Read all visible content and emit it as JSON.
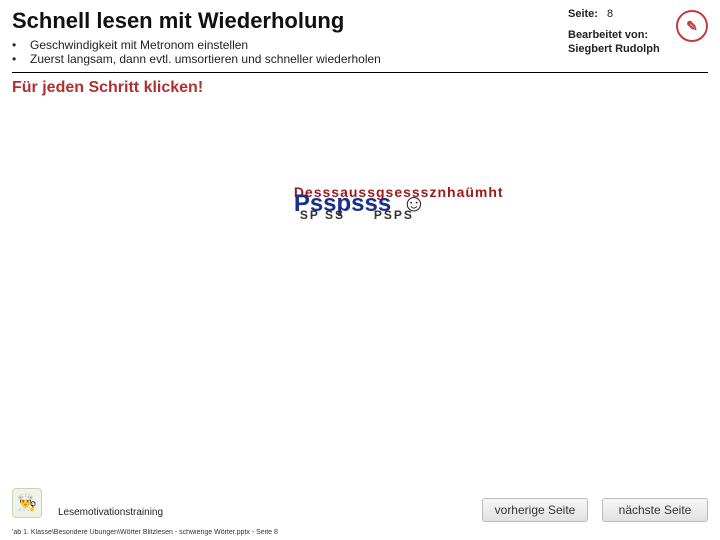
{
  "header": {
    "title": "Schnell lesen mit Wiederholung",
    "bullets": [
      "Geschwindigkeit mit Metronom einstellen",
      "Zuerst langsam, dann evtl. umsortieren und schneller wiederholen"
    ],
    "seite_label": "Seite:",
    "seite_num": "8",
    "edited_label": "Bearbeitet von:",
    "edited_name": "Siegbert Rudolph"
  },
  "instruction": "Für jeden Schritt klicken!",
  "center": {
    "word": "Psspsss",
    "overlay1": "Desssaussgsesssznhaümht",
    "overlay2": "SP SS",
    "overlay3": "PSPS",
    "smiley": "☺"
  },
  "footer": {
    "logo_glyph": "👨‍🍳",
    "title": "Lesemotivationstraining",
    "path": "'ab 1. Klasse\\Besondere Übungen\\Wörter Blitzlesen - schwierige Wörter.pptx - Seite 8",
    "prev": "vorherige Seite",
    "next": "nächste Seite"
  }
}
